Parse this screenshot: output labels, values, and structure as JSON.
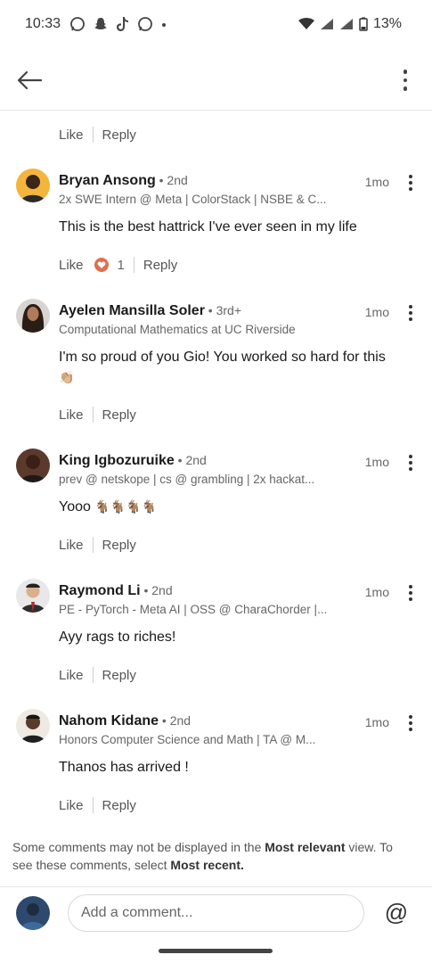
{
  "status_bar": {
    "time": "10:33",
    "battery": "13%"
  },
  "first_comment_actions": {
    "like": "Like",
    "reply": "Reply"
  },
  "comments": [
    {
      "name": "Bryan Ansong",
      "degree": " • 2nd",
      "headline": "2x SWE Intern @ Meta | ColorStack | NSBE & C...",
      "time": "1mo",
      "text": "This is the best hattrick I've ever seen in my life",
      "like": "Like",
      "reaction_count": "1",
      "reply": "Reply"
    },
    {
      "name": "Ayelen Mansilla Soler",
      "degree": " • 3rd+",
      "headline": "Computational Mathematics at UC Riverside",
      "time": "1mo",
      "text": "I'm so proud of you Gio! You worked so hard for this",
      "emoji": "👏🏼",
      "like": "Like",
      "reply": "Reply"
    },
    {
      "name": "King Igbozuruike",
      "degree": " • 2nd",
      "headline": "prev @ netskope | cs @ grambling | 2x hackat...",
      "time": "1mo",
      "text": "Yooo",
      "emoji": "🐐🐐🐐🐐",
      "like": "Like",
      "reply": "Reply"
    },
    {
      "name": "Raymond Li",
      "degree": " • 2nd",
      "headline": "PE - PyTorch - Meta AI | OSS @ CharaChorder |...",
      "time": "1mo",
      "text": "Ayy rags to riches!",
      "like": "Like",
      "reply": "Reply"
    },
    {
      "name": "Nahom Kidane",
      "degree": " • 2nd",
      "headline": "Honors Computer Science and Math | TA @ M...",
      "time": "1mo",
      "text": "Thanos has arrived !",
      "like": "Like",
      "reply": "Reply"
    }
  ],
  "notice": {
    "part1": "Some comments may not be displayed in the ",
    "bold1": "Most relevant",
    "part2": " view. To see these comments, select ",
    "bold2": "Most recent."
  },
  "composer": {
    "placeholder": "Add a comment...",
    "at_symbol": "@"
  },
  "icons": [
    "back-arrow-icon",
    "more-vertical-icon",
    "heart-reaction-icon",
    "wifi-icon",
    "signal-icon",
    "battery-icon",
    "whatsapp-icon",
    "snapchat-icon",
    "tiktok-icon"
  ],
  "colors": {
    "reaction": "#df704d",
    "text_primary": "#1a1a1a",
    "text_secondary": "#666666"
  }
}
